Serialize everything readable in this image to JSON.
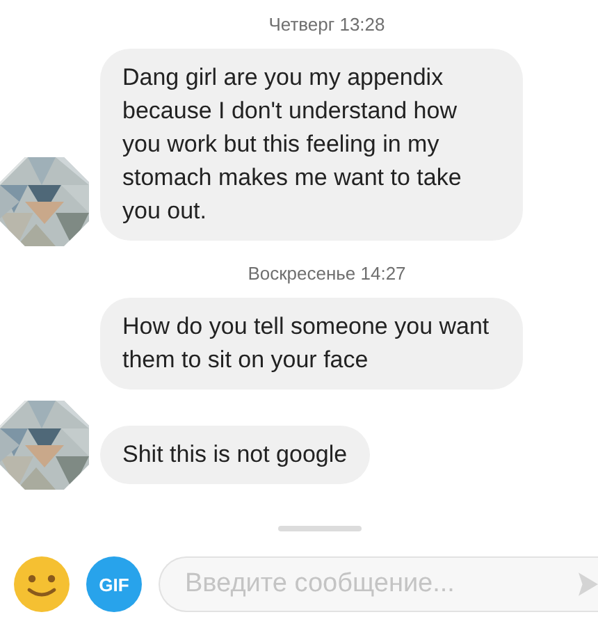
{
  "groups": [
    {
      "timestamp": "Четверг 13:28",
      "messages": [
        "Dang girl are you my appendix because I don't understand how you work but this feeling in my stomach makes me want to take you out."
      ]
    },
    {
      "timestamp": "Воскресенье 14:27",
      "messages": [
        "How do you tell someone you want them to sit on your face",
        "Shit this is not google"
      ]
    }
  ],
  "composer": {
    "gif_label": "GIF",
    "placeholder": "Введите сообщение..."
  }
}
